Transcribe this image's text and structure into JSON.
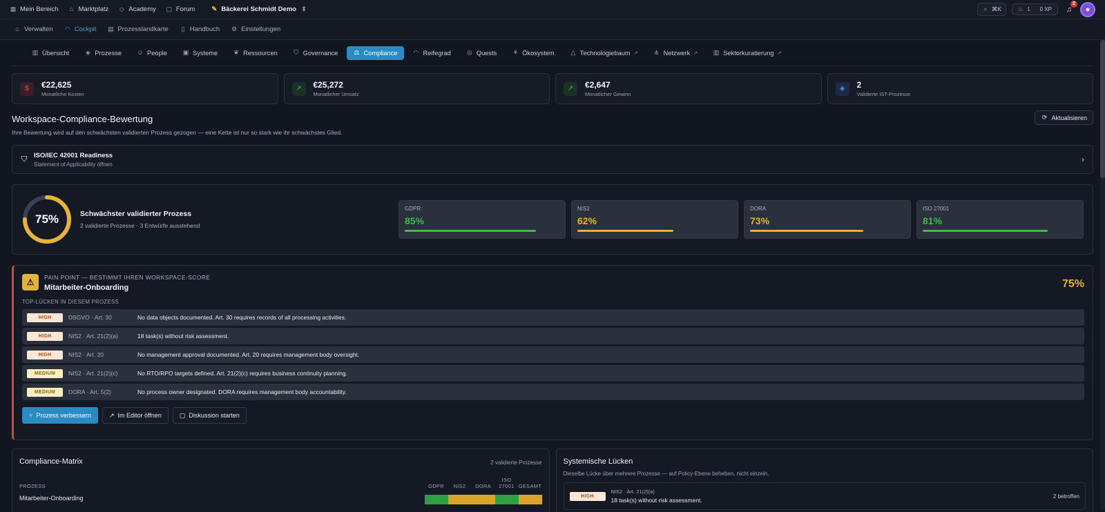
{
  "topnav": {
    "items": [
      {
        "label": "Mein Bereich",
        "icon": "grid-icon"
      },
      {
        "label": "Marktplatz",
        "icon": "store-icon"
      },
      {
        "label": "Academy",
        "icon": "graduation-cap-icon"
      },
      {
        "label": "Forum",
        "icon": "chat-icon"
      }
    ],
    "workspace": "Bäckerei Schmidt Demo",
    "search_shortcut": "⌘K",
    "streak": "1",
    "xp": "0 XP",
    "notifications": "2"
  },
  "subnav": [
    {
      "label": "Verwalten",
      "icon": "home-icon"
    },
    {
      "label": "Cockpit",
      "icon": "gauge-icon",
      "active": true
    },
    {
      "label": "Prozesslandkarte",
      "icon": "map-icon"
    },
    {
      "label": "Handbuch",
      "icon": "book-icon"
    },
    {
      "label": "Einstellungen",
      "icon": "gear-icon"
    }
  ],
  "tabs": [
    {
      "label": "Übersicht",
      "icon": "chart-icon"
    },
    {
      "label": "Prozesse",
      "icon": "layers-icon"
    },
    {
      "label": "People",
      "icon": "people-icon"
    },
    {
      "label": "Systeme",
      "icon": "cpu-icon"
    },
    {
      "label": "Ressourcen",
      "icon": "leaf-icon"
    },
    {
      "label": "Governance",
      "icon": "shield-icon"
    },
    {
      "label": "Compliance",
      "icon": "scale-icon",
      "active": true
    },
    {
      "label": "Reifegrad",
      "icon": "gauge-icon"
    },
    {
      "label": "Quests",
      "icon": "target-icon"
    },
    {
      "label": "Ökosystem",
      "icon": "sprout-icon"
    },
    {
      "label": "Technologiebaum",
      "icon": "triangle-icon",
      "external": true
    },
    {
      "label": "Netzwerk",
      "icon": "network-icon",
      "external": true
    },
    {
      "label": "Sektorkuratierung",
      "icon": "building-icon",
      "external": true
    }
  ],
  "kpis": [
    {
      "value": "€22,625",
      "label": "Monatliche Kosten",
      "icon": "dollar-icon",
      "color": "#e5484d",
      "bg": "#3a1f26"
    },
    {
      "value": "€25,272",
      "label": "Monatlicher Umsatz",
      "icon": "trend-up-icon",
      "color": "#3fb950",
      "bg": "#1c3026"
    },
    {
      "value": "€2,647",
      "label": "Monatlicher Gewinn",
      "icon": "trend-up-icon",
      "color": "#3fb950",
      "bg": "#1c3026"
    },
    {
      "value": "2",
      "label": "Validierte IST-Prozesse",
      "icon": "layers-icon",
      "color": "#5b8def",
      "bg": "#1e2a45"
    }
  ],
  "section": {
    "title": "Workspace-Compliance-Bewertung",
    "subtitle": "Ihre Bewertung wird auf den schwächsten validierten Prozess gezogen — eine Kette ist nur so stark wie ihr schwächstes Glied.",
    "refresh": "Aktualisieren"
  },
  "iso": {
    "title": "ISO/IEC 42001 Readiness",
    "subtitle": "Statement of Applicability öffnen"
  },
  "score": {
    "value": "75%",
    "fraction": 0.75,
    "title": "Schwächster validierter Prozess",
    "subtitle": "2 validierte Prozesse · 3 Entwürfe ausstehend"
  },
  "frameworks": [
    {
      "name": "GDPR",
      "value": "85%",
      "pct": 85,
      "color": "#3fb950"
    },
    {
      "name": "NIS2",
      "value": "62%",
      "pct": 62,
      "color": "#e7b23b"
    },
    {
      "name": "DORA",
      "value": "73%",
      "pct": 73,
      "color": "#e7b23b"
    },
    {
      "name": "ISO 27001",
      "value": "81%",
      "pct": 81,
      "color": "#3fb950"
    }
  ],
  "pain": {
    "kicker": "PAIN POINT — BESTIMMT IHREN WORKSPACE-SCORE",
    "title": "Mitarbeiter-Onboarding",
    "pct": "75%",
    "gaps_heading": "TOP-LÜCKEN IN DIESEM PROZESS",
    "gaps": [
      {
        "sev": "HIGH",
        "ref": "DSGVO · Art. 30",
        "text": "No data objects documented. Art. 30 requires records of all processing activities."
      },
      {
        "sev": "HIGH",
        "ref": "NIS2 · Art. 21(2)(a)",
        "text": "18 task(s) without risk assessment."
      },
      {
        "sev": "HIGH",
        "ref": "NIS2 · Art. 20",
        "text": "No management approval documented. Art. 20 requires management body oversight."
      },
      {
        "sev": "MEDIUM",
        "ref": "NIS2 · Art. 21(2)(c)",
        "text": "No RTO/RPO targets defined. Art. 21(2)(c) requires business continuity planning."
      },
      {
        "sev": "MEDIUM",
        "ref": "DORA · Art. 5(2)",
        "text": "No process owner designated. DORA requires management body accountability."
      }
    ],
    "actions": {
      "improve": "Prozess verbessern",
      "editor": "Im Editor öffnen",
      "discuss": "Diskussion starten"
    }
  },
  "matrix": {
    "title": "Compliance-Matrix",
    "meta": "2 validierte Prozesse",
    "col_process": "PROZESS",
    "cols": [
      "GDPR",
      "NIS2",
      "DORA",
      "ISO 27001",
      "GESAMT"
    ],
    "row_label": "Mitarbeiter-Onboarding",
    "row_colors": [
      "#2ea043",
      "#d8a52a",
      "#d8a52a",
      "#2ea043",
      "#d8a52a"
    ]
  },
  "systemic": {
    "title": "Systemische Lücken",
    "subtitle": "Dieselbe Lücke über mehrere Prozesse — auf Policy-Ebene beheben, nicht einzeln.",
    "item": {
      "sev": "HIGH",
      "ref": "NIS2 · Art. 21(2)(a)",
      "text": "18 task(s) without risk assessment.",
      "count": "2 betroffen"
    }
  }
}
